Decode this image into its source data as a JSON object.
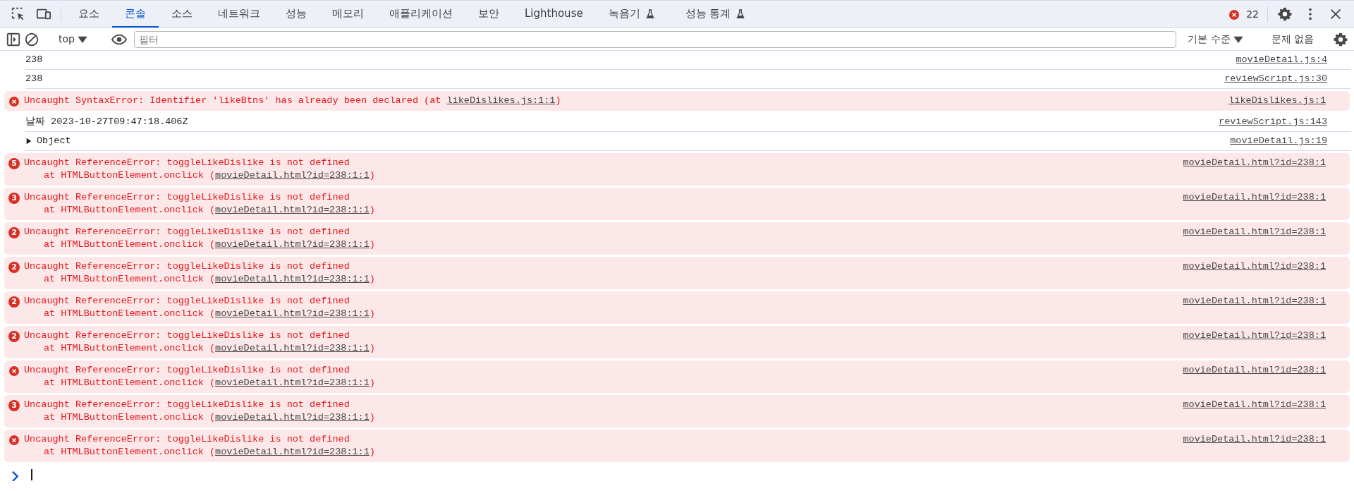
{
  "tabs": [
    {
      "label": "요소",
      "selected": false,
      "experimental": false
    },
    {
      "label": "콘솔",
      "selected": true,
      "experimental": false
    },
    {
      "label": "소스",
      "selected": false,
      "experimental": false
    },
    {
      "label": "네트워크",
      "selected": false,
      "experimental": false
    },
    {
      "label": "성능",
      "selected": false,
      "experimental": false
    },
    {
      "label": "메모리",
      "selected": false,
      "experimental": false
    },
    {
      "label": "애플리케이션",
      "selected": false,
      "experimental": false
    },
    {
      "label": "보안",
      "selected": false,
      "experimental": false
    },
    {
      "label": "Lighthouse",
      "selected": false,
      "experimental": false
    },
    {
      "label": "녹음기",
      "selected": false,
      "experimental": true
    },
    {
      "label": "성능 통계",
      "selected": false,
      "experimental": true
    }
  ],
  "error_count": "22",
  "toolbar": {
    "context": "top",
    "filter": {
      "placeholder": "필터"
    },
    "level": "기본 수준",
    "issues": "문제 없음"
  },
  "messages": [
    {
      "kind": "log",
      "text": "238",
      "source": "movieDetail.js:4"
    },
    {
      "kind": "log",
      "text": "238",
      "source": "reviewScript.js:30"
    },
    {
      "kind": "error",
      "text": "Uncaught SyntaxError: Identifier 'likeBtns' has already been declared (at ",
      "link": "likeDislikes.js:1:1",
      "after": ")",
      "source": "likeDislikes.js:1"
    },
    {
      "kind": "log",
      "text": "날짜 2023-10-27T09:47:18.406Z",
      "source": "reviewScript.js:143"
    },
    {
      "kind": "object",
      "text": "Object",
      "source": "movieDetail.js:19"
    },
    {
      "kind": "error",
      "count": "5",
      "text": "Uncaught ReferenceError: toggleLikeDislike is not defined",
      "stack": "at HTMLButtonElement.onclick (",
      "link": "movieDetail.html?id=238:1:1",
      "after": ")",
      "source": "movieDetail.html?id=238:1"
    },
    {
      "kind": "error",
      "count": "3",
      "text": "Uncaught ReferenceError: toggleLikeDislike is not defined",
      "stack": "at HTMLButtonElement.onclick (",
      "link": "movieDetail.html?id=238:1:1",
      "after": ")",
      "source": "movieDetail.html?id=238:1"
    },
    {
      "kind": "error",
      "count": "2",
      "text": "Uncaught ReferenceError: toggleLikeDislike is not defined",
      "stack": "at HTMLButtonElement.onclick (",
      "link": "movieDetail.html?id=238:1:1",
      "after": ")",
      "source": "movieDetail.html?id=238:1"
    },
    {
      "kind": "error",
      "count": "2",
      "text": "Uncaught ReferenceError: toggleLikeDislike is not defined",
      "stack": "at HTMLButtonElement.onclick (",
      "link": "movieDetail.html?id=238:1:1",
      "after": ")",
      "source": "movieDetail.html?id=238:1"
    },
    {
      "kind": "error",
      "count": "2",
      "text": "Uncaught ReferenceError: toggleLikeDislike is not defined",
      "stack": "at HTMLButtonElement.onclick (",
      "link": "movieDetail.html?id=238:1:1",
      "after": ")",
      "source": "movieDetail.html?id=238:1"
    },
    {
      "kind": "error",
      "count": "2",
      "text": "Uncaught ReferenceError: toggleLikeDislike is not defined",
      "stack": "at HTMLButtonElement.onclick (",
      "link": "movieDetail.html?id=238:1:1",
      "after": ")",
      "source": "movieDetail.html?id=238:1"
    },
    {
      "kind": "error",
      "text": "Uncaught ReferenceError: toggleLikeDislike is not defined",
      "stack": "at HTMLButtonElement.onclick (",
      "link": "movieDetail.html?id=238:1:1",
      "after": ")",
      "source": "movieDetail.html?id=238:1"
    },
    {
      "kind": "error",
      "count": "3",
      "text": "Uncaught ReferenceError: toggleLikeDislike is not defined",
      "stack": "at HTMLButtonElement.onclick (",
      "link": "movieDetail.html?id=238:1:1",
      "after": ")",
      "source": "movieDetail.html?id=238:1"
    },
    {
      "kind": "error",
      "text": "Uncaught ReferenceError: toggleLikeDislike is not defined",
      "stack": "at HTMLButtonElement.onclick (",
      "link": "movieDetail.html?id=238:1:1",
      "after": ")",
      "source": "movieDetail.html?id=238:1"
    }
  ]
}
